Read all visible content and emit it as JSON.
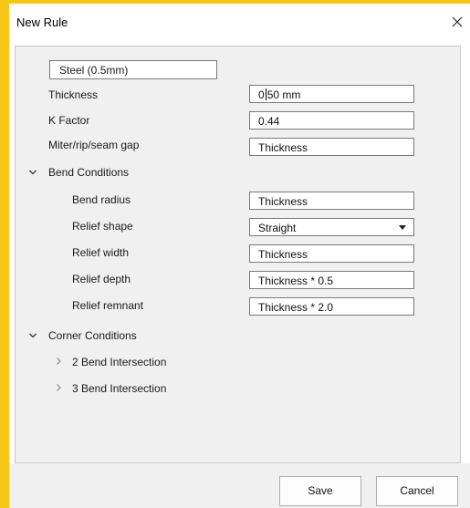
{
  "window": {
    "title": "New Rule"
  },
  "rule_name": "Steel (0.5mm)",
  "fields": {
    "thickness": {
      "label": "Thickness",
      "value_before_caret": "0",
      "value_after_caret": "50 mm"
    },
    "k_factor": {
      "label": "K Factor",
      "value": "0.44"
    },
    "gap": {
      "label": "Miter/rip/seam gap",
      "value": "Thickness"
    }
  },
  "bend_conditions": {
    "label": "Bend Conditions",
    "bend_radius": {
      "label": "Bend radius",
      "value": "Thickness"
    },
    "relief_shape": {
      "label": "Relief shape",
      "value": "Straight"
    },
    "relief_width": {
      "label": "Relief width",
      "value": "Thickness"
    },
    "relief_depth": {
      "label": "Relief depth",
      "value": "Thickness * 0.5"
    },
    "relief_remnant": {
      "label": "Relief remnant",
      "value": "Thickness * 2.0"
    }
  },
  "corner_conditions": {
    "label": "Corner Conditions",
    "items": [
      "2 Bend Intersection",
      "3 Bend Intersection"
    ]
  },
  "buttons": {
    "save": "Save",
    "cancel": "Cancel"
  },
  "colors": {
    "frame": "#f5c518",
    "panel": "#f0f0f0",
    "field_border": "#7a7a7a"
  },
  "icons": {
    "close": "close-icon",
    "expanded": "chevron-down-icon",
    "collapsed": "chevron-right-icon"
  }
}
